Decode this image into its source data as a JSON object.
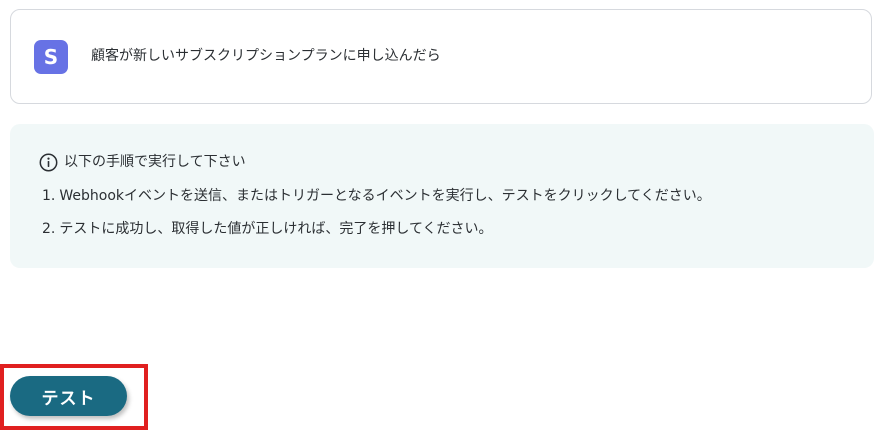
{
  "trigger": {
    "app_icon_letter": "S",
    "app_icon_color": "#6772e5",
    "label": "顧客が新しいサブスクリプションプランに申し込んだら"
  },
  "instructions": {
    "heading": "以下の手順で実行して下さい",
    "steps": [
      {
        "number": "1.",
        "text": "Webhookイベントを送信、またはトリガーとなるイベントを実行し、テストをクリックしてください。"
      },
      {
        "number": "2.",
        "text": "テストに成功し、取得した値が正しければ、完了を押してください。"
      }
    ],
    "panel_color": "#f1f8f8"
  },
  "actions": {
    "test_label": "テスト",
    "test_color": "#1a6a82",
    "highlight_color": "#e02020"
  }
}
